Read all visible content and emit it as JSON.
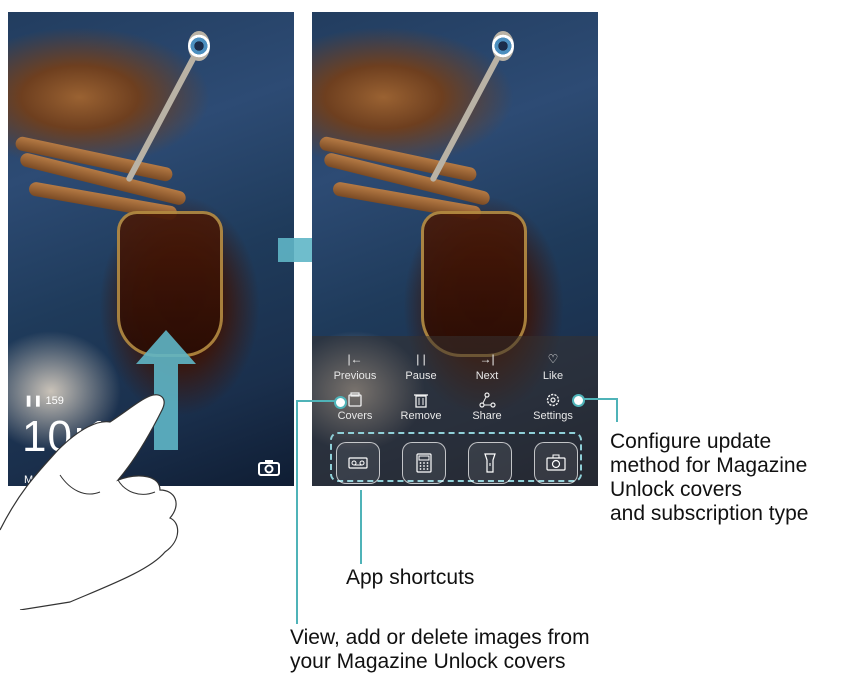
{
  "left_screen": {
    "steps": "159",
    "clock": "10:12",
    "date_prefix": "M"
  },
  "right_screen": {
    "controls_row1": [
      {
        "icon": "previous-icon",
        "glyph": "|←",
        "label": "Previous"
      },
      {
        "icon": "pause-icon",
        "glyph": "| |",
        "label": "Pause"
      },
      {
        "icon": "next-icon",
        "glyph": "→|",
        "label": "Next"
      },
      {
        "icon": "heart-icon",
        "glyph": "♡",
        "label": "Like"
      }
    ],
    "controls_row2": [
      {
        "icon": "covers-icon",
        "label": "Covers"
      },
      {
        "icon": "trash-icon",
        "label": "Remove"
      },
      {
        "icon": "share-icon",
        "label": "Share"
      },
      {
        "icon": "gear-icon",
        "label": "Settings"
      }
    ],
    "shortcuts": [
      "voicemail-icon",
      "calculator-icon",
      "flashlight-icon",
      "camera-icon"
    ]
  },
  "callouts": {
    "settings": [
      "Configure update",
      "method for Magazine",
      "Unlock covers",
      "and subscription type"
    ],
    "shortcuts": "App shortcuts",
    "covers": [
      "View, add or delete images from",
      "your Magazine Unlock covers"
    ]
  },
  "colors": {
    "accent": "#4fb3b8",
    "dashed": "#8fd0d8"
  }
}
